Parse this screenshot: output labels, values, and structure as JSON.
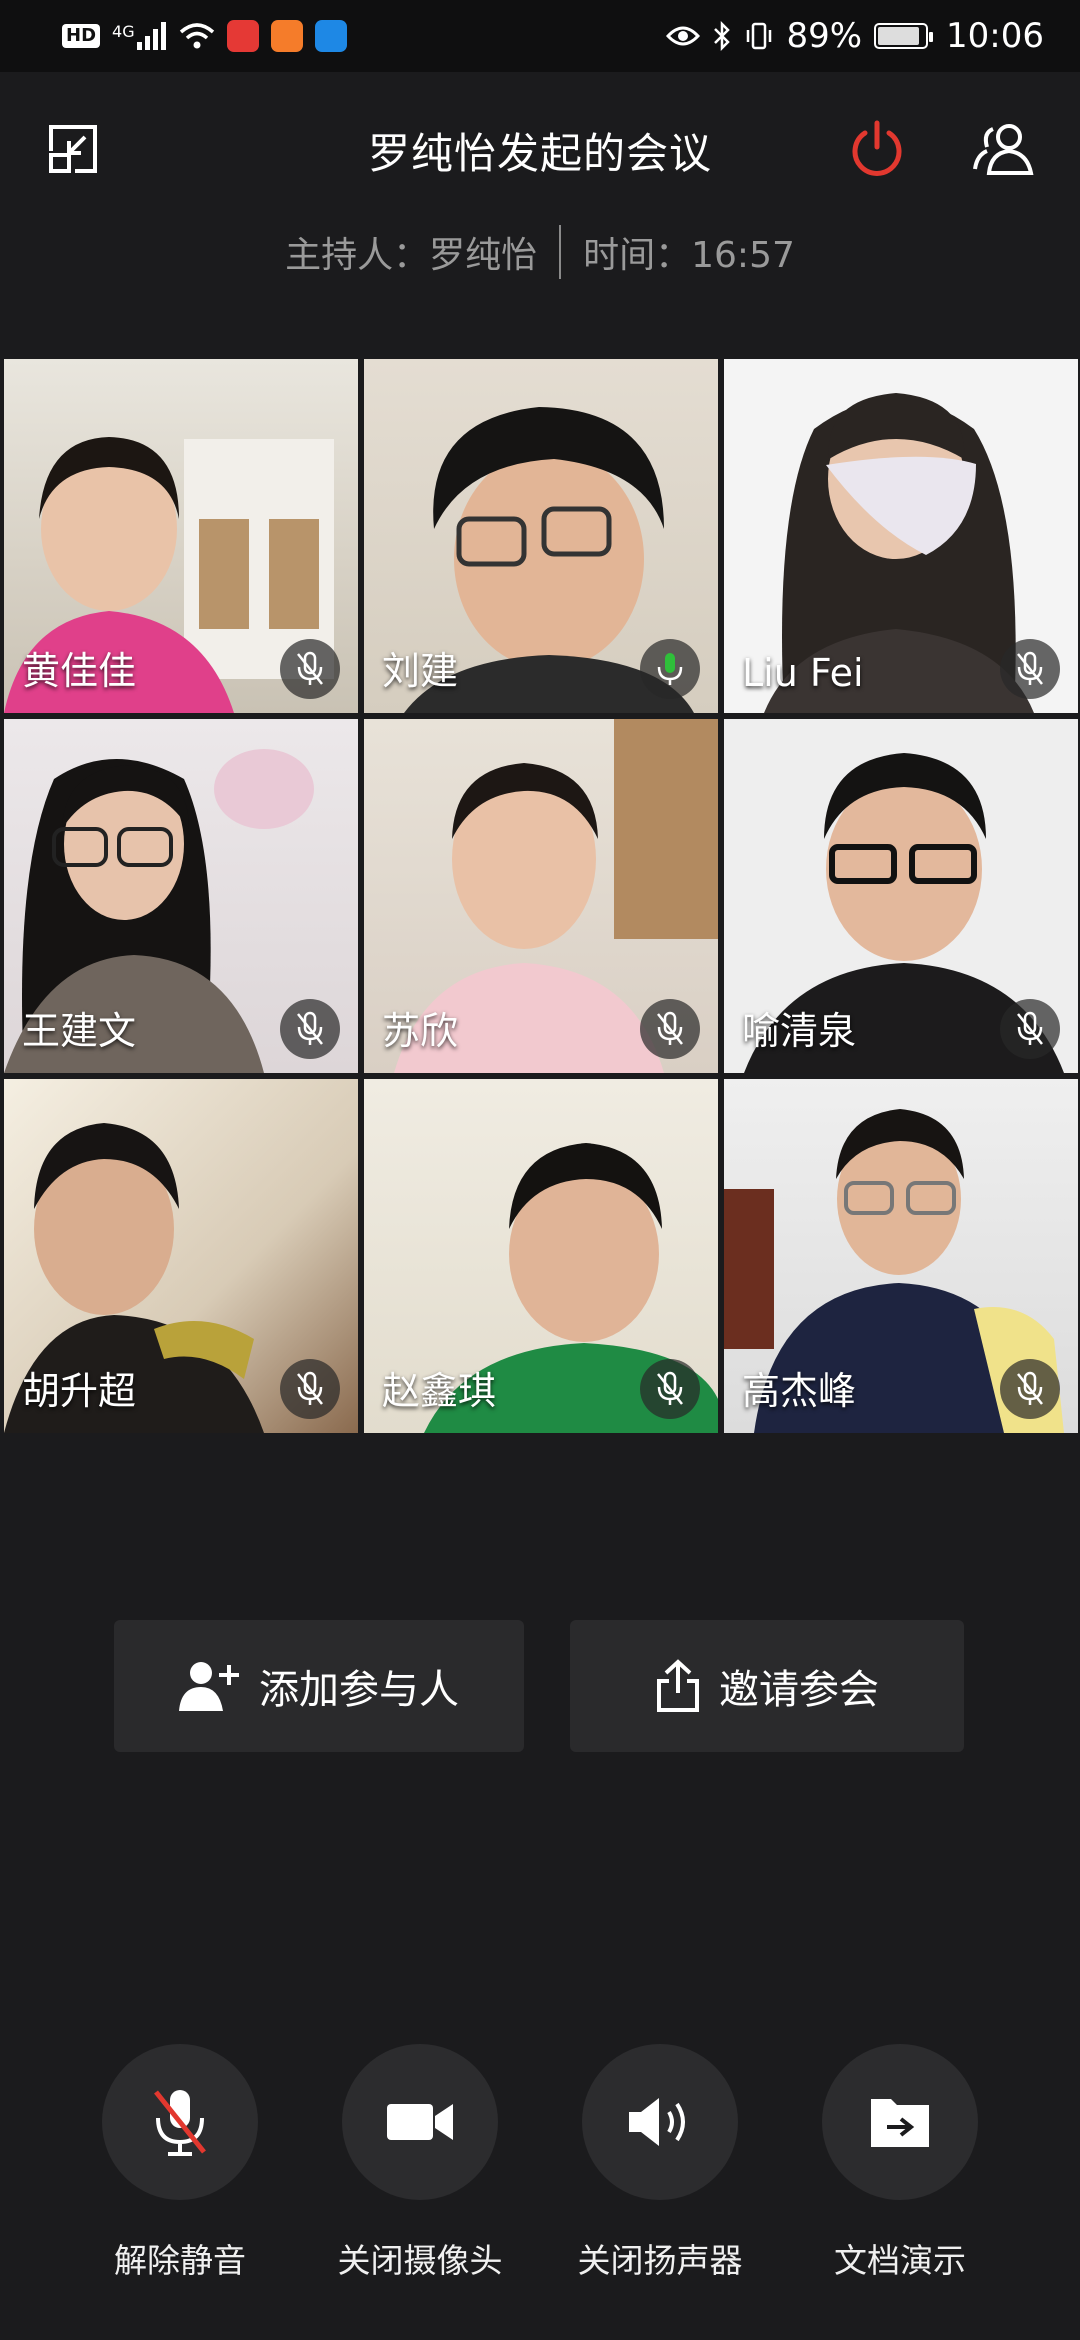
{
  "status_bar": {
    "hd_badge": "HD",
    "network": "4G",
    "battery_percent": "89%",
    "battery_level": 0.89,
    "time": "10:06"
  },
  "header": {
    "title": "罗纯怡发起的会议",
    "host_label": "主持人：罗纯怡",
    "time_label": "时间：16:57",
    "end_color": "#e2382f"
  },
  "participants": [
    {
      "name": "黄佳佳",
      "mic": "muted"
    },
    {
      "name": "刘建",
      "mic": "speaking"
    },
    {
      "name": "Liu Fei",
      "mic": "muted"
    },
    {
      "name": "王建文",
      "mic": "muted"
    },
    {
      "name": "苏欣",
      "mic": "muted"
    },
    {
      "name": "喻清泉",
      "mic": "muted"
    },
    {
      "name": "胡升超",
      "mic": "muted"
    },
    {
      "name": "赵鑫琪",
      "mic": "muted"
    },
    {
      "name": "高杰峰",
      "mic": "muted"
    }
  ],
  "actions": {
    "add_participant": "添加参与人",
    "invite": "邀请参会"
  },
  "controls": {
    "unmute": "解除静音",
    "camera_off": "关闭摄像头",
    "speaker_off": "关闭扬声器",
    "doc_share": "文档演示"
  },
  "colors": {
    "speaking_green": "#2fbf3a",
    "muted_red": "#e2382f"
  }
}
